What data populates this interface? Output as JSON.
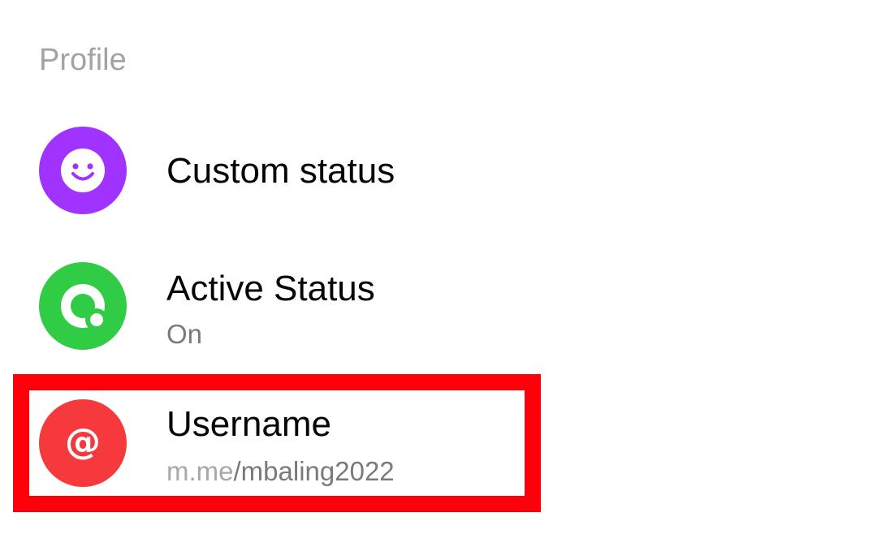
{
  "section": {
    "header": "Profile"
  },
  "items": [
    {
      "title": "Custom status",
      "icon": "smiley-face-icon",
      "icon_color": "#a033ff"
    },
    {
      "title": "Active Status",
      "subtitle": "On",
      "icon": "active-status-icon",
      "icon_color": "#31cc46"
    },
    {
      "title": "Username",
      "subtitle_prefix": "m.me",
      "subtitle_value": "/mbaling2022",
      "icon": "at-sign-icon",
      "icon_color": "#f5393c"
    }
  ],
  "highlight": {
    "color": "#ff000a"
  }
}
